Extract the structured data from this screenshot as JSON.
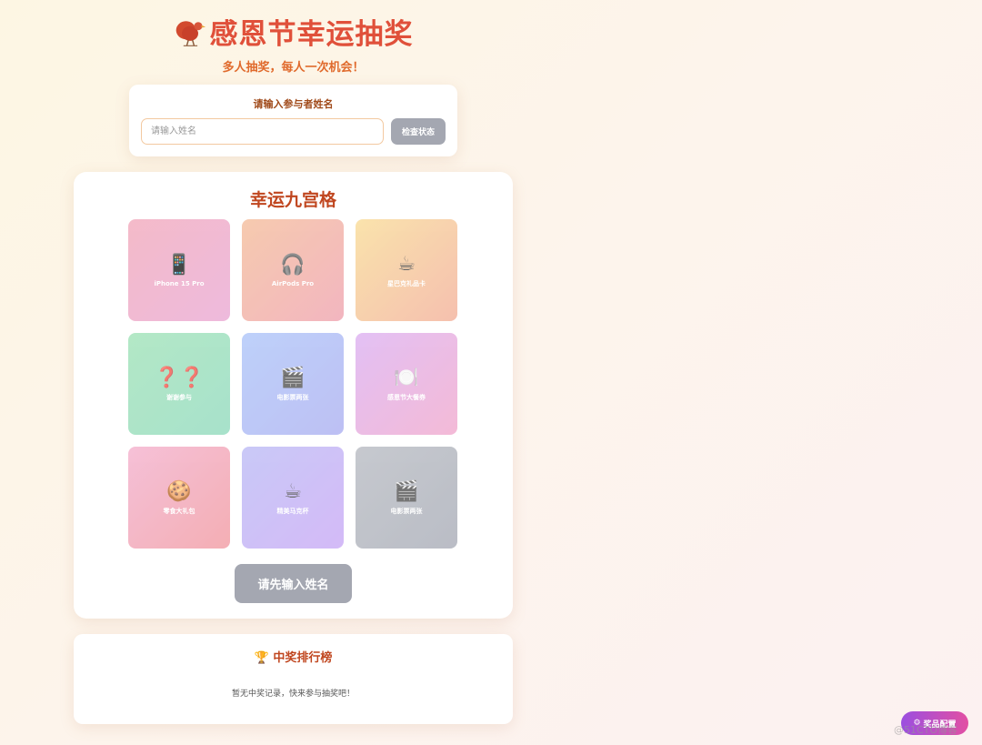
{
  "header": {
    "title": "感恩节幸运抽奖",
    "subtitle": "多人抽奖，每人一次机会！",
    "logo_icon": "turkey-icon"
  },
  "name_form": {
    "label": "请输入参与者姓名",
    "placeholder": "请输入姓名",
    "value": "",
    "check_button": "检查状态"
  },
  "grid": {
    "title": "幸运九宫格",
    "cells": [
      {
        "icon": "📱",
        "label": "iPhone 15 Pro",
        "color_from": "#f0a0b4",
        "color_to": "#e8a0d0"
      },
      {
        "icon": "🎧",
        "label": "AirPods Pro",
        "color_from": "#f3b690",
        "color_to": "#ee9aa8"
      },
      {
        "icon": "☕",
        "label": "星巴克礼品卡",
        "color_from": "#f8d88c",
        "color_to": "#f2a890"
      },
      {
        "icon": "❓❓",
        "label": "谢谢参与",
        "color_from": "#96dfb0",
        "color_to": "#86d7b8"
      },
      {
        "icon": "🎬",
        "label": "电影票两张",
        "color_from": "#a4bff8",
        "color_to": "#a4a8f0"
      },
      {
        "icon": "🍽️",
        "label": "感恩节大餐券",
        "color_from": "#d8a8f0",
        "color_to": "#f0a0c8"
      },
      {
        "icon": "🍪",
        "label": "零食大礼包",
        "color_from": "#f2a8c8",
        "color_to": "#f09098"
      },
      {
        "icon": "☕",
        "label": "精美马克杯",
        "color_from": "#b4b4f4",
        "color_to": "#c4a0f4"
      },
      {
        "icon": "🎬",
        "label": "电影票两张",
        "color_from": "#b0b4bc",
        "color_to": "#a0a4b0"
      }
    ],
    "draw_button": "请先输入姓名"
  },
  "ranking": {
    "icon": "🏆",
    "title": "中奖排行榜",
    "empty_text": "暂无中奖记录，快来参与抽奖吧！"
  },
  "prize_config": {
    "icon": "⚙",
    "label": "奖品配置"
  },
  "watermark": "@51CTO博客"
}
